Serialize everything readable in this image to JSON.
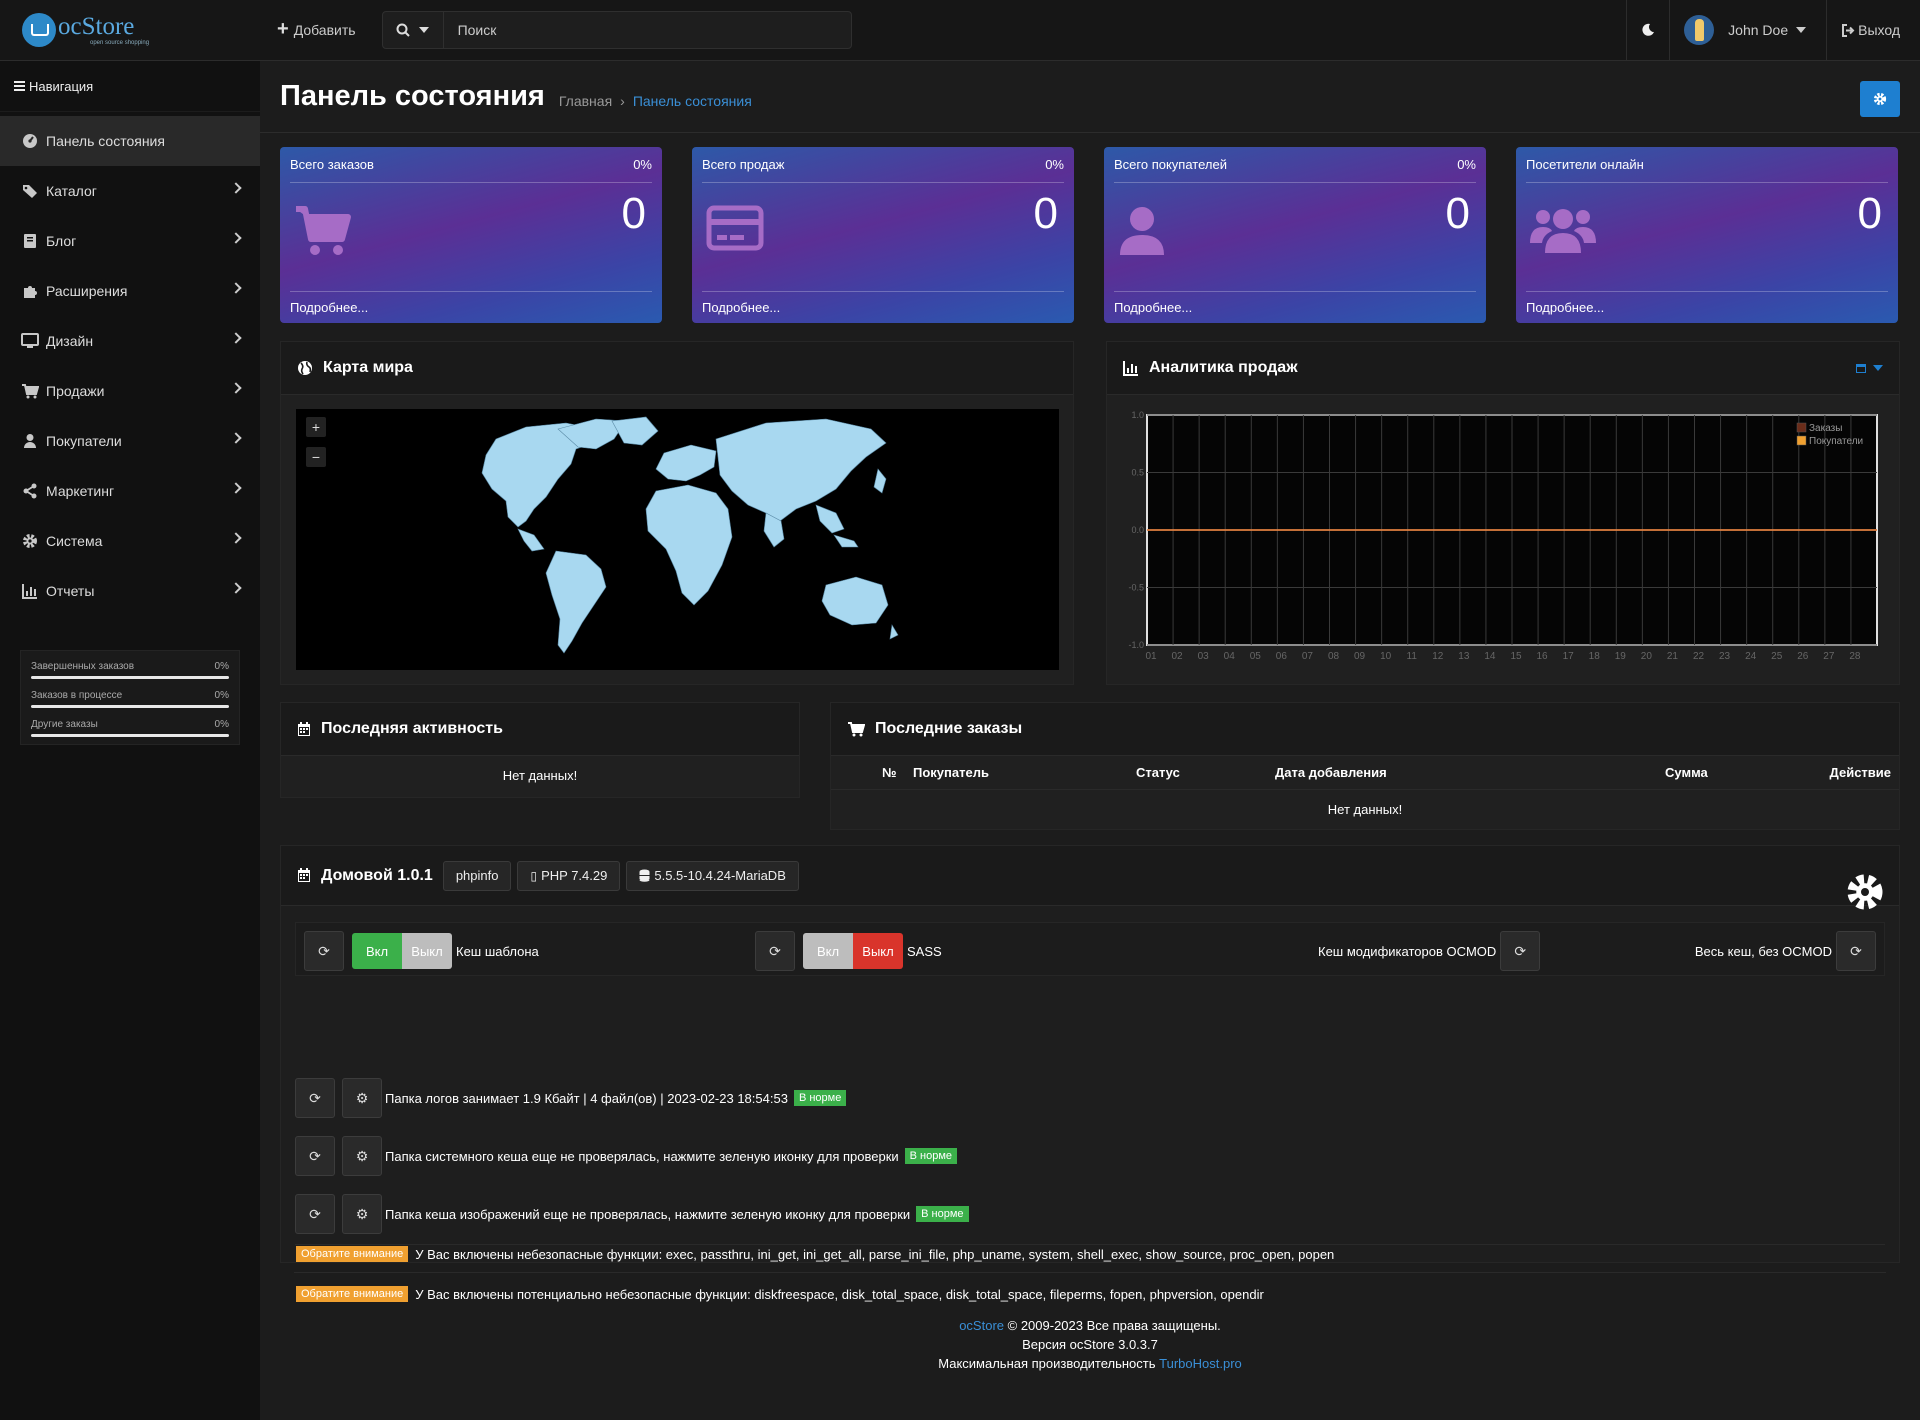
{
  "app": {
    "logo_name": "ocStore",
    "logo_sub": "open source shopping"
  },
  "header": {
    "add_label": "Добавить",
    "search_placeholder": "Поиск",
    "user_name": "John Doe",
    "logout_label": "Выход"
  },
  "sidebar": {
    "title": "Навигация",
    "items": [
      {
        "label": "Панель состояния",
        "icon": "dashboard-icon"
      },
      {
        "label": "Каталог",
        "icon": "tag-icon"
      },
      {
        "label": "Блог",
        "icon": "book-icon"
      },
      {
        "label": "Расширения",
        "icon": "puzzle-icon"
      },
      {
        "label": "Дизайн",
        "icon": "monitor-icon"
      },
      {
        "label": "Продажи",
        "icon": "cart-icon"
      },
      {
        "label": "Покупатели",
        "icon": "user-icon"
      },
      {
        "label": "Маркетинг",
        "icon": "share-icon"
      },
      {
        "label": "Система",
        "icon": "gear-icon"
      },
      {
        "label": "Отчеты",
        "icon": "bar-chart-icon"
      }
    ],
    "stats": [
      {
        "label": "Завершенных заказов",
        "value": "0%"
      },
      {
        "label": "Заказов в процессе",
        "value": "0%"
      },
      {
        "label": "Другие заказы",
        "value": "0%"
      }
    ]
  },
  "page": {
    "title": "Панель состояния",
    "breadcrumb": [
      "Главная",
      "Панель состояния"
    ]
  },
  "tiles": [
    {
      "title": "Всего заказов",
      "percent": "0%",
      "value": "0",
      "more": "Подробнее...",
      "icon": "cart-icon"
    },
    {
      "title": "Всего продаж",
      "percent": "0%",
      "value": "0",
      "more": "Подробнее...",
      "icon": "credit-card-icon"
    },
    {
      "title": "Всего покупателей",
      "percent": "0%",
      "value": "0",
      "more": "Подробнее...",
      "icon": "user-icon"
    },
    {
      "title": "Посетители онлайн",
      "percent": "",
      "value": "0",
      "more": "Подробнее...",
      "icon": "users-icon"
    }
  ],
  "map_panel": {
    "title": "Карта мира",
    "zoom_in": "+",
    "zoom_out": "−"
  },
  "sales_panel": {
    "title": "Аналитика продаж"
  },
  "chart_data": {
    "type": "line",
    "categories": [
      "01",
      "02",
      "03",
      "04",
      "05",
      "06",
      "07",
      "08",
      "09",
      "10",
      "11",
      "12",
      "13",
      "14",
      "15",
      "16",
      "17",
      "18",
      "19",
      "20",
      "21",
      "22",
      "23",
      "24",
      "25",
      "26",
      "27",
      "28"
    ],
    "series": [
      {
        "name": "Заказы",
        "values": [
          0,
          0,
          0,
          0,
          0,
          0,
          0,
          0,
          0,
          0,
          0,
          0,
          0,
          0,
          0,
          0,
          0,
          0,
          0,
          0,
          0,
          0,
          0,
          0,
          0,
          0,
          0,
          0
        ]
      },
      {
        "name": "Покупатели",
        "values": [
          0,
          0,
          0,
          0,
          0,
          0,
          0,
          0,
          0,
          0,
          0,
          0,
          0,
          0,
          0,
          0,
          0,
          0,
          0,
          0,
          0,
          0,
          0,
          0,
          0,
          0,
          0,
          0
        ]
      }
    ],
    "y_ticks": [
      "1.0",
      "0.5",
      "0.0",
      "-0.5",
      "-1.0"
    ],
    "ylim": [
      -1,
      1
    ],
    "legend": "top-right",
    "grid": true,
    "colors": {
      "Заказы": "#6b2d1a",
      "Покупатели": "#f0a030",
      "line": "#e08040"
    }
  },
  "activity_panel": {
    "title": "Последняя активность",
    "empty": "Нет данных!"
  },
  "orders_panel": {
    "title": "Последние заказы",
    "columns": [
      "№",
      "Покупатель",
      "Статус",
      "Дата добавления",
      "Сумма",
      "Действие"
    ],
    "empty": "Нет данных!"
  },
  "domovoy": {
    "title": "Домовой 1.0.1",
    "badges": [
      "phpinfo",
      "PHP 7.4.29",
      "5.5.5-10.4.24-MariaDB"
    ],
    "cache_template": {
      "on": "Вкл",
      "off": "Выкл",
      "label": "Кеш шаблона"
    },
    "sass": {
      "on": "Вкл",
      "off": "Выкл",
      "label": "SASS"
    },
    "ocmod_label": "Кеш модификаторов OCMOD",
    "all_cache_label": "Весь кеш, без OCMOD",
    "rows": [
      {
        "text": "Папка логов занимает 1.9 Кбайт | 4 файл(ов) | 2023-02-23 18:54:53",
        "status": "В норме"
      },
      {
        "text": "Папка системного кеша еще не проверялась, нажмите зеленую иконку для проверки",
        "status": "В норме"
      },
      {
        "text": "Папка кеша изображений еще не проверялась, нажмите зеленую иконку для проверки",
        "status": "В норме"
      }
    ],
    "warnings": [
      {
        "badge": "Обратите внимание",
        "text": "У Вас включены небезопасные функции: exec, passthru, ini_get, ini_get_all, parse_ini_file, php_uname, system, shell_exec, show_source, proc_open, popen"
      },
      {
        "badge": "Обратите внимание",
        "text": "У Вас включены потенциально небезопасные функции: diskfreespace, disk_total_space, disk_total_space, fileperms, fopen, phpversion, opendir"
      }
    ]
  },
  "footer": {
    "brand": "ocStore",
    "copyright": "© 2009-2023 Все права защищены.",
    "version": "Версия ocStore 3.0.3.7",
    "perf": "Максимальная производительность",
    "host": "TurboHost.pro"
  },
  "colors": {
    "accent": "#1e7fd0",
    "ok": "#3bb04a",
    "warn": "#f0a030",
    "on": "#3bb04a",
    "off_red": "#d9342b"
  }
}
